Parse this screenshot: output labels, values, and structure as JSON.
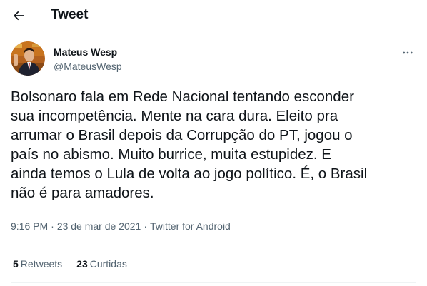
{
  "header": {
    "title": "Tweet",
    "back_icon": "arrow-left-icon"
  },
  "author": {
    "name": "Mateus Wesp",
    "handle": "@MateusWesp",
    "avatar_icon": "avatar",
    "more_icon": "more-horizontal-icon"
  },
  "tweet": {
    "text": "Bolsonaro fala em Rede Nacional tentando esconder\nsua incompetência. Mente na cara dura. Eleito pra\narrumar o Brasil depois da Corrupção do PT, jogou o\npaís no abismo. Muito burrice, muita estupidez. E\nainda temos o Lula de volta ao jogo político. É, o Brasil\nnão é para amadores.",
    "time": "9:16 PM",
    "separator": "·",
    "date": "23 de mar de 2021",
    "source": "Twitter for Android"
  },
  "stats": {
    "retweets_count": "5",
    "retweets_label": "Retweets",
    "likes_count": "23",
    "likes_label": "Curtidas"
  },
  "colors": {
    "text_primary": "#0f1419",
    "text_secondary": "#536471",
    "divider": "#eff3f4"
  }
}
